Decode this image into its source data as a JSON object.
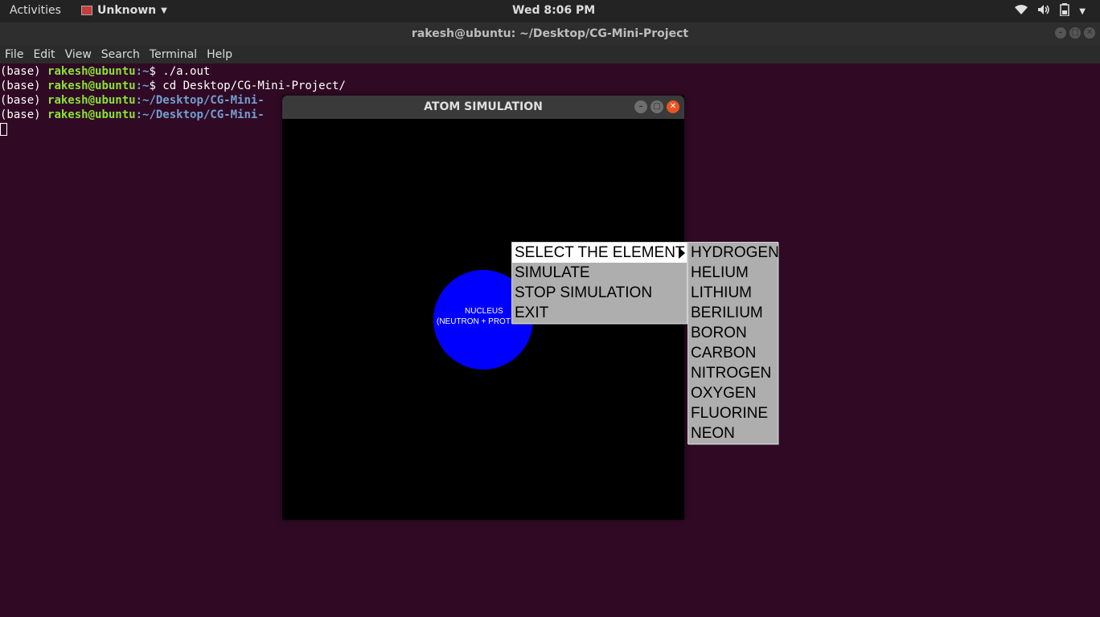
{
  "topbar": {
    "activities": "Activities",
    "app_name": "Unknown",
    "clock": "Wed  8:06 PM",
    "icons": [
      "wifi-icon",
      "volume-icon",
      "battery-icon",
      "power-menu-icon"
    ]
  },
  "terminal": {
    "title": "rakesh@ubuntu: ~/Desktop/CG-Mini-Project",
    "menu": [
      "File",
      "Edit",
      "View",
      "Search",
      "Terminal",
      "Help"
    ],
    "lines": [
      {
        "prefix": "(base) ",
        "user": "rakesh@ubuntu",
        "path": ":~",
        "cmd": "$ ./a.out"
      },
      {
        "prefix": "(base) ",
        "user": "rakesh@ubuntu",
        "path": ":~",
        "cmd": "$ cd Desktop/CG-Mini-Project/"
      },
      {
        "prefix": "(base) ",
        "user": "rakesh@ubuntu",
        "path": ":~/Desktop/CG-Mini-",
        "cmd": ""
      },
      {
        "prefix": "(base) ",
        "user": "rakesh@ubuntu",
        "path": ":~/Desktop/CG-Mini-",
        "cmd": ""
      }
    ]
  },
  "atom_window": {
    "title": "ATOM SIMULATION",
    "nucleus_line1": "NUCLEUS",
    "nucleus_line2": "(NEUTRON + PROT",
    "nucleus_color": "#0000ff"
  },
  "main_menu": {
    "items": [
      "SELECT THE ELEMENT",
      "SIMULATE",
      "STOP SIMULATION",
      "EXIT"
    ],
    "highlighted": "SELECT THE ELEMENT"
  },
  "element_menu": {
    "items": [
      "HYDROGEN",
      "HELIUM",
      "LITHIUM",
      "BERILIUM",
      "BORON",
      "CARBON",
      "NITROGEN",
      "OXYGEN",
      "FLUORINE",
      "NEON"
    ]
  }
}
